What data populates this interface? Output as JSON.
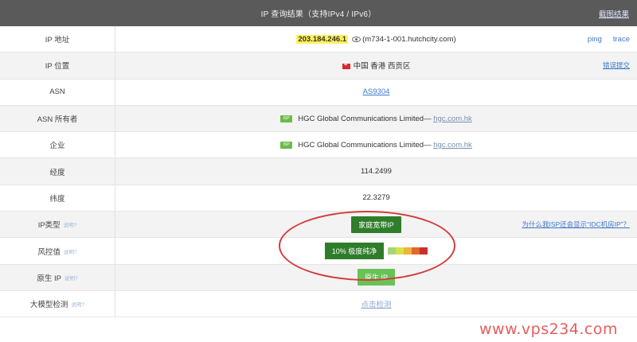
{
  "header": {
    "title": "IP 查询结果（支持IPv4 / IPv6）",
    "screenshot_link": "截图结果"
  },
  "rows": {
    "ip": {
      "label": "IP 地址",
      "value": "203.184.246.1",
      "host": "(m734-1-001.hutchcity.com)",
      "ping": "ping",
      "trace": "trace"
    },
    "location": {
      "label": "IP 位置",
      "value": "中国 香港 西贡区",
      "report": "错误提交"
    },
    "asn": {
      "label": "ASN",
      "value": "AS9304"
    },
    "asn_owner": {
      "label": "ASN 所有者",
      "badge": "ISP",
      "name": "HGC Global Communications Limited—",
      "domain": "hgc.com.hk"
    },
    "company": {
      "label": "企业",
      "badge": "ISP",
      "name": "HGC Global Communications Limited—",
      "domain": "hgc.com.hk"
    },
    "longitude": {
      "label": "经度",
      "value": "114.2499"
    },
    "latitude": {
      "label": "纬度",
      "value": "22.3279"
    },
    "ip_type": {
      "label": "IP类型",
      "hint": "说明?",
      "value": "家庭宽带IP",
      "question": "为什么我ISP还会显示“IDC机房IP”？"
    },
    "risk": {
      "label": "风控值",
      "hint": "说明?",
      "value": "10%  极度纯净"
    },
    "native": {
      "label": "原生 IP",
      "hint": "说明?",
      "value": "原生 IP"
    },
    "llm": {
      "label": "大模型检测",
      "hint": "说明?",
      "value": "点击检测"
    }
  },
  "risk_colors": [
    "#a6d776",
    "#d7e04a",
    "#f0b43a",
    "#e06a2a",
    "#c9302c"
  ],
  "watermark": "www.vps234.com"
}
